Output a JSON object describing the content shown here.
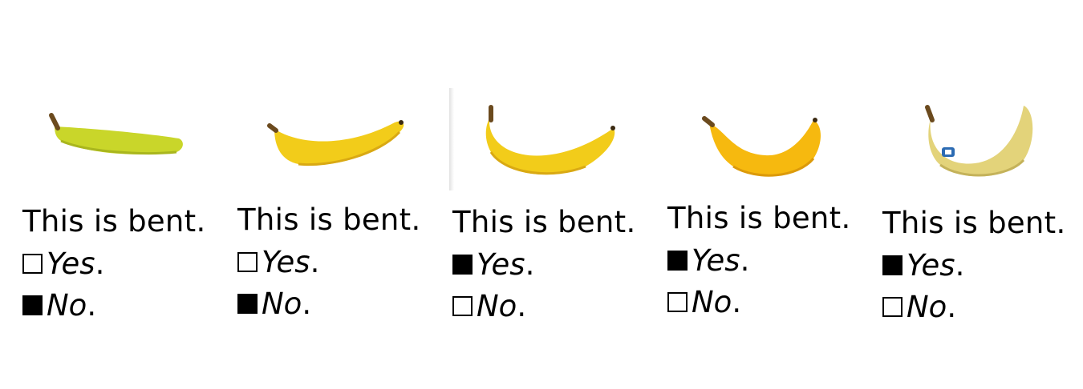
{
  "panels": [
    {
      "caption": "This is bent.",
      "options": [
        {
          "label": "Yes",
          "checked": false
        },
        {
          "label": "No",
          "checked": true
        }
      ],
      "image": "straight-green-banana"
    },
    {
      "caption": "This is bent.",
      "options": [
        {
          "label": "Yes",
          "checked": false
        },
        {
          "label": "No",
          "checked": true
        }
      ],
      "image": "slightly-curved-banana"
    },
    {
      "caption": "This is bent.",
      "options": [
        {
          "label": "Yes",
          "checked": true
        },
        {
          "label": "No",
          "checked": false
        }
      ],
      "image": "curved-banana"
    },
    {
      "caption": "This is bent.",
      "options": [
        {
          "label": "Yes",
          "checked": true
        },
        {
          "label": "No",
          "checked": false
        }
      ],
      "image": "strongly-curved-banana"
    },
    {
      "caption": "This is bent.",
      "options": [
        {
          "label": "Yes",
          "checked": true
        },
        {
          "label": "No",
          "checked": false
        }
      ],
      "image": "very-curved-banana-with-sticker"
    }
  ],
  "colors": {
    "green_banana": "#c9d62a",
    "yellow_banana": "#f2cc1a",
    "ripe_banana": "#f6b90f",
    "pale_banana": "#e3d37a",
    "stem": "#6b4a1e"
  },
  "punctuation": "."
}
